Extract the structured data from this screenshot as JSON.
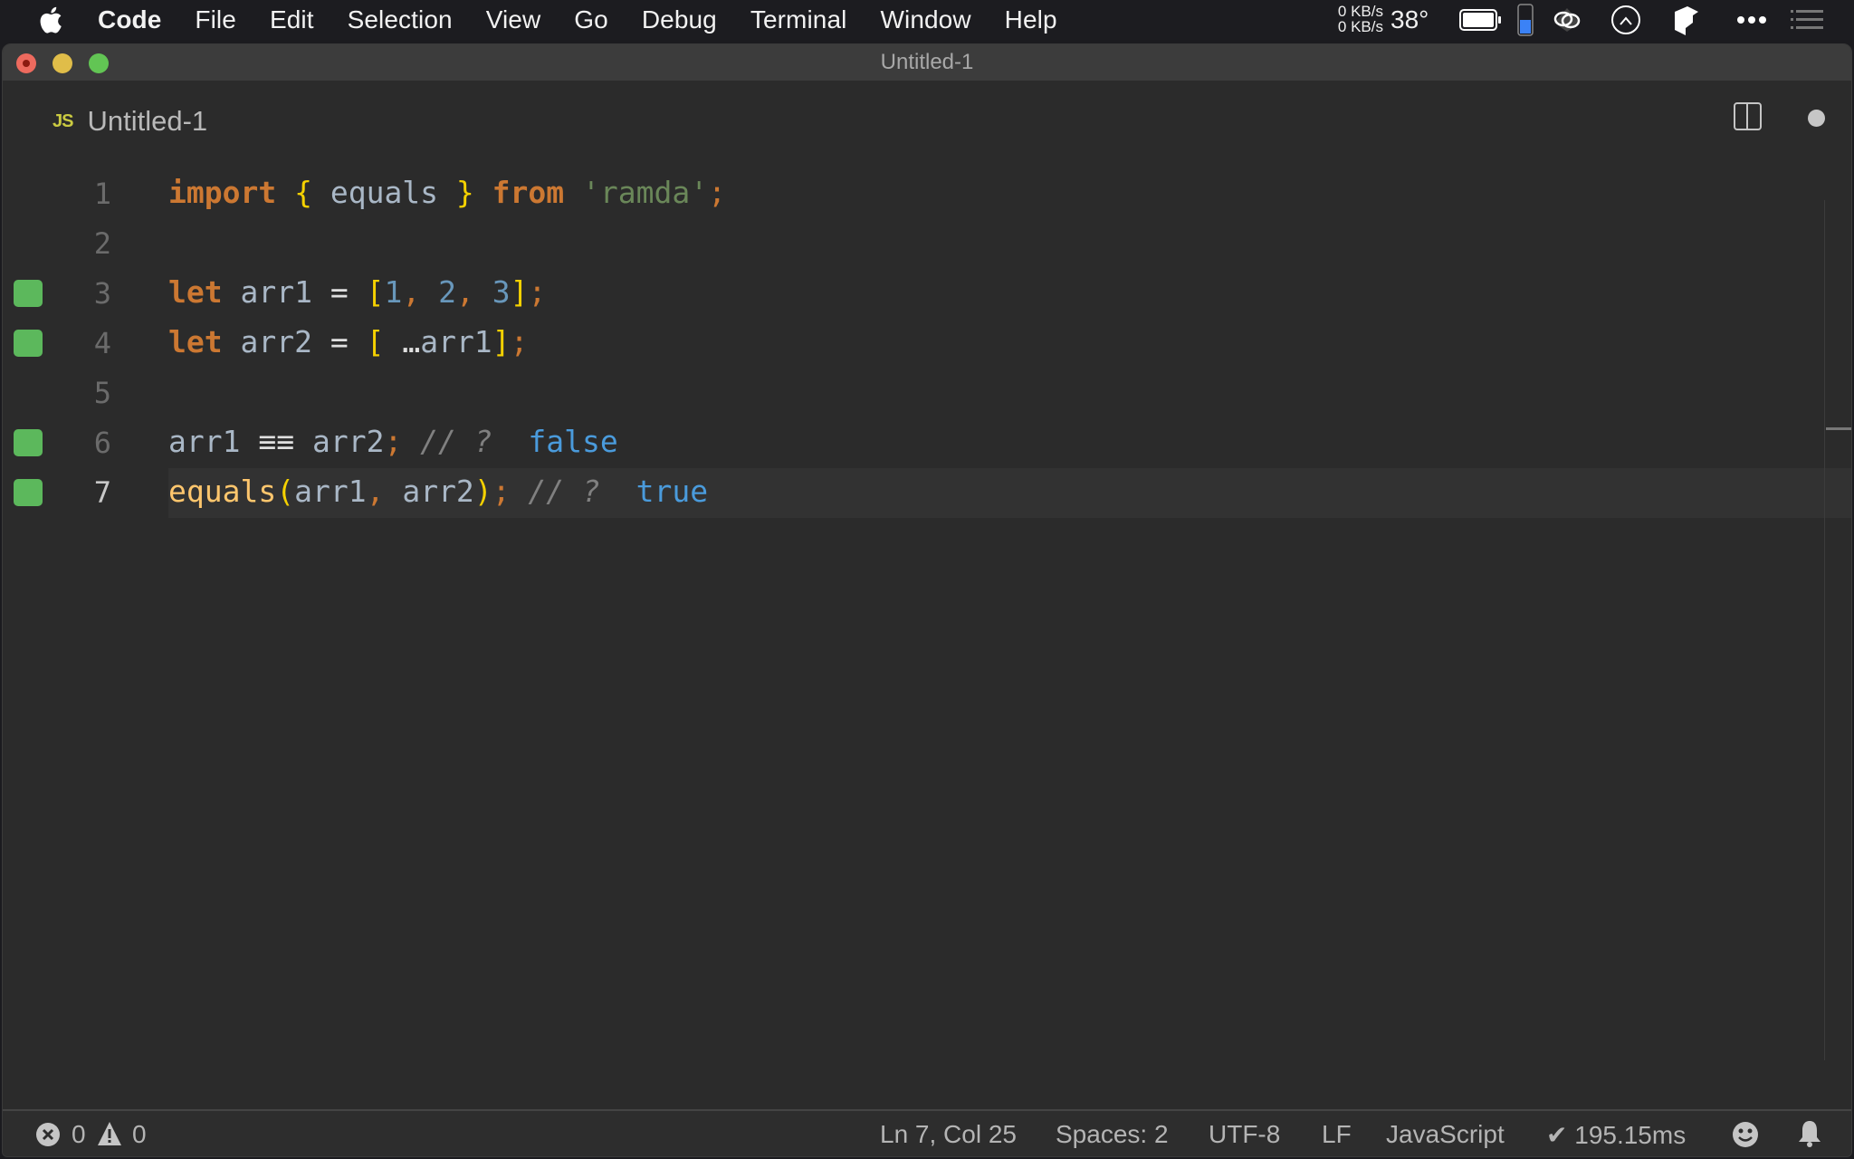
{
  "menubar": {
    "app_name": "Code",
    "items": [
      "File",
      "Edit",
      "Selection",
      "View",
      "Go",
      "Debug",
      "Terminal",
      "Window",
      "Help"
    ],
    "tray": {
      "net_up": "0 KB/s",
      "net_down": "0 KB/s",
      "temperature": "38°",
      "battery_icon": "battery-icon",
      "memory_level": 0.5,
      "icons": [
        "creative-cloud-icon",
        "istat-menus-icon",
        "dropbox-icon",
        "more-icon",
        "notification-center-icon"
      ]
    }
  },
  "window": {
    "title": "Untitled-1"
  },
  "tab": {
    "file_type_badge": "JS",
    "name": "Untitled-1",
    "dirty": true
  },
  "editor": {
    "lines": [
      {
        "number": "1",
        "coverage": false,
        "tokens": [
          [
            "kw",
            "import"
          ],
          [
            "p",
            " "
          ],
          [
            "br",
            "{"
          ],
          [
            "id",
            " equals "
          ],
          [
            "br",
            "}"
          ],
          [
            "p",
            " "
          ],
          [
            "kw",
            "from"
          ],
          [
            "p",
            " "
          ],
          [
            "str",
            "'ramda'"
          ],
          [
            "pun",
            ";"
          ]
        ]
      },
      {
        "number": "2",
        "coverage": false,
        "tokens": []
      },
      {
        "number": "3",
        "coverage": true,
        "tokens": [
          [
            "kw",
            "let"
          ],
          [
            "id",
            " arr1 "
          ],
          [
            "op",
            "="
          ],
          [
            "p",
            " "
          ],
          [
            "br",
            "["
          ],
          [
            "num",
            "1"
          ],
          [
            "pun",
            ", "
          ],
          [
            "num",
            "2"
          ],
          [
            "pun",
            ", "
          ],
          [
            "num",
            "3"
          ],
          [
            "br",
            "]"
          ],
          [
            "pun",
            ";"
          ]
        ]
      },
      {
        "number": "4",
        "coverage": true,
        "tokens": [
          [
            "kw",
            "let"
          ],
          [
            "id",
            " arr2 "
          ],
          [
            "op",
            "="
          ],
          [
            "p",
            " "
          ],
          [
            "br",
            "["
          ],
          [
            "op",
            " …"
          ],
          [
            "id",
            "arr1"
          ],
          [
            "br",
            "]"
          ],
          [
            "pun",
            ";"
          ]
        ]
      },
      {
        "number": "5",
        "coverage": false,
        "tokens": []
      },
      {
        "number": "6",
        "coverage": true,
        "tokens": [
          [
            "id",
            "arr1 "
          ],
          [
            "op",
            "≡≡"
          ],
          [
            "id",
            " arr2"
          ],
          [
            "pun",
            ";"
          ],
          [
            "cm",
            " // ?  "
          ],
          [
            "res",
            "false"
          ]
        ]
      },
      {
        "number": "7",
        "coverage": true,
        "current": true,
        "tokens": [
          [
            "fn",
            "equals"
          ],
          [
            "br",
            "("
          ],
          [
            "id",
            "arr1"
          ],
          [
            "pun",
            ", "
          ],
          [
            "id",
            "arr2"
          ],
          [
            "br",
            ")"
          ],
          [
            "pun",
            ";"
          ],
          [
            "cm",
            " // ?  "
          ],
          [
            "res",
            "true"
          ]
        ]
      }
    ]
  },
  "statusbar": {
    "errors": "0",
    "warnings": "0",
    "cursor": "Ln 7, Col 25",
    "indent": "Spaces: 2",
    "encoding": "UTF-8",
    "eol": "LF",
    "language": "JavaScript",
    "quokka_time": "✔ 195.15ms"
  }
}
